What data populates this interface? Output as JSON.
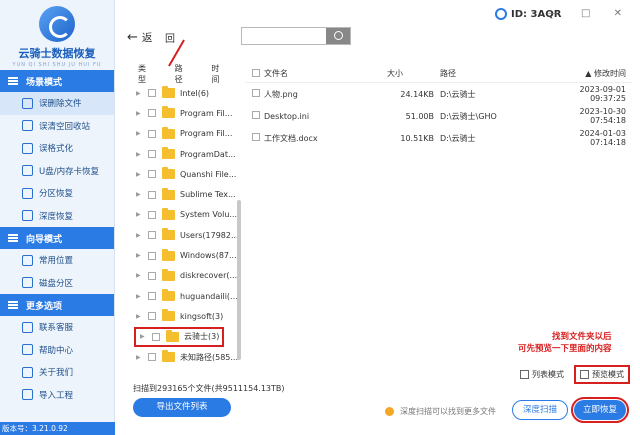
{
  "app": {
    "name": "云骑士数据恢复",
    "pinyin": "YUN QI SHI SHU JU HUI FU",
    "version": "版本号：3.21.0.92"
  },
  "sidebar": {
    "sections": [
      {
        "title": "场景模式",
        "items": [
          "误删除文件",
          "误清空回收站",
          "误格式化",
          "U盘/内存卡恢复",
          "分区恢复",
          "深度恢复"
        ]
      },
      {
        "title": "向导模式",
        "items": [
          "常用位置",
          "磁盘分区"
        ]
      },
      {
        "title": "更多选项",
        "items": [
          "联系客服",
          "帮助中心",
          "关于我们",
          "导入工程"
        ]
      }
    ]
  },
  "header": {
    "back": "返",
    "home": "回",
    "user_id": "ID: 3AQR",
    "window_controls": "— □ ✕"
  },
  "tree": {
    "headers": [
      "类型",
      "路径",
      "时间"
    ],
    "rows": [
      "Intel(6)",
      "Program Fil...",
      "Program Fil...",
      "ProgramDat...",
      "Quanshi File...",
      "Sublime Tex...",
      "System Volu...",
      "Users(17982...",
      "Windows(87...",
      "diskrecover(...",
      "huguandaili(...",
      "kingsoft(3)",
      "云骑士(3)",
      "未知路径(585..."
    ]
  },
  "table": {
    "headers": [
      "文件名",
      "大小",
      "路径",
      "修改时间"
    ],
    "rows": [
      {
        "name": "人物.png",
        "size": "24.14KB",
        "path": "D:\\云骑士",
        "date": "2023-09-01 09:37:25"
      },
      {
        "name": "Desktop.ini",
        "size": "51.00B",
        "path": "D:\\云骑士\\GHO",
        "date": "2023-10-30 07:54:18"
      },
      {
        "name": "工作文档.docx",
        "size": "10.51KB",
        "path": "D:\\云骑士",
        "date": "2024-01-03 07:14:18"
      }
    ]
  },
  "callout": {
    "line1": "找到文件夹以后",
    "line2": "可先预览一下里面的内容"
  },
  "view_modes": {
    "list": "列表模式",
    "preview": "预览模式"
  },
  "footer": {
    "scanned": "扫描到293165个文件(共9511154.13TB)",
    "export_button": "导出文件列表",
    "hint": "深度扫描可以找到更多文件",
    "deep_scan_button": "深度扫描",
    "restore_button": "立即恢复"
  }
}
